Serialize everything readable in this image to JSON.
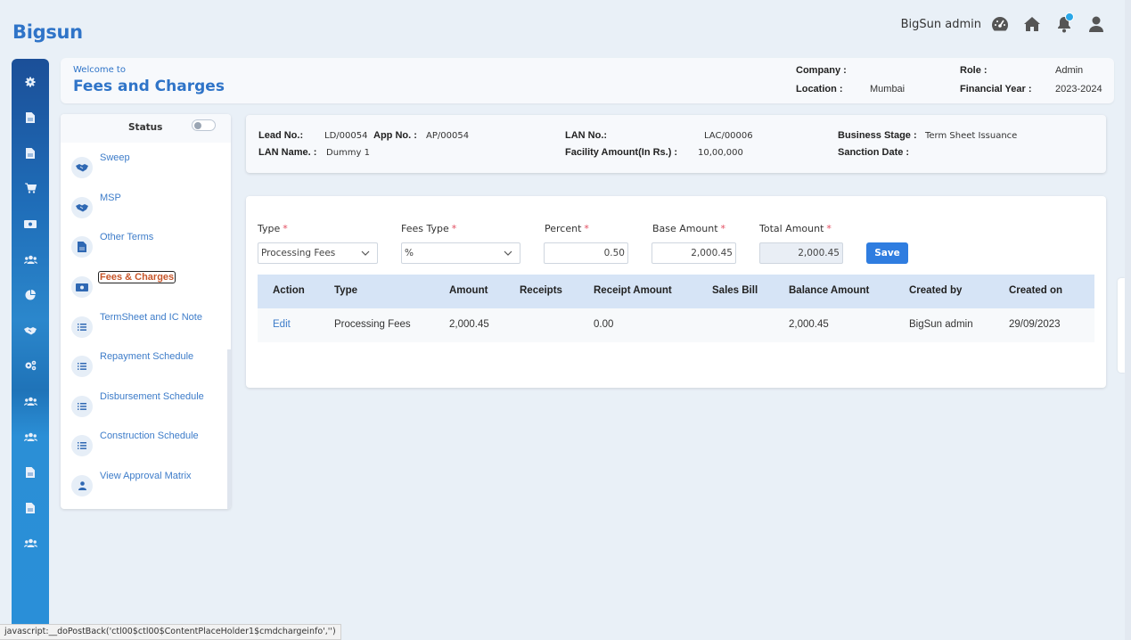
{
  "brand": "Bigsun",
  "topbar": {
    "user_name": "BigSun admin",
    "icons": [
      "dashboard-icon",
      "home-icon",
      "bell-icon",
      "user-icon"
    ],
    "notification_badge": true
  },
  "icon_rail": [
    "gear-icon",
    "document-icon",
    "document-icon",
    "cart-icon",
    "money-icon",
    "users-icon",
    "pie-chart-icon",
    "handshake-icon",
    "cogs-icon",
    "users-icon",
    "users-icon",
    "document-icon",
    "document-icon",
    "users-icon"
  ],
  "welcome": {
    "small": "Welcome to",
    "title": "Fees and Charges",
    "company_label": "Company :",
    "company_value": "",
    "location_label": "Location :",
    "location_value": "Mumbai",
    "role_label": "Role :",
    "role_value": "Admin",
    "fy_label": "Financial Year :",
    "fy_value": "2023-2024"
  },
  "left_panel": {
    "status_label": "Status",
    "status_toggle_on": false,
    "items": [
      {
        "label": "Sweep",
        "icon": "handshake-icon"
      },
      {
        "label": "MSP",
        "icon": "handshake-icon"
      },
      {
        "label": "Other Terms",
        "icon": "document-icon"
      },
      {
        "label": "Fees & Charges",
        "icon": "money-icon",
        "active": true
      },
      {
        "label": "TermSheet and IC Note",
        "icon": "list-icon"
      },
      {
        "label": "Repayment Schedule",
        "icon": "list-icon"
      },
      {
        "label": "Disbursement Schedule",
        "icon": "list-icon"
      },
      {
        "label": "Construction Schedule",
        "icon": "list-icon"
      },
      {
        "label": "View Approval Matrix",
        "icon": "user-icon"
      }
    ]
  },
  "info": {
    "lead_no_label": "Lead No.:",
    "lead_no": "LD/00054",
    "app_no_label": "App No. :",
    "app_no": "AP/00054",
    "lan_name_label": "LAN Name. :",
    "lan_name": "Dummy 1",
    "lan_no_label": "LAN No.:",
    "lan_no": "LAC/00006",
    "facility_label": "Facility Amount(In Rs.) :",
    "facility": "10,00,000",
    "stage_label": "Business Stage :",
    "stage": "Term Sheet Issuance",
    "sanction_label": "Sanction Date :",
    "sanction": ""
  },
  "form": {
    "type_label": "Type",
    "type_value": "Processing Fees",
    "fees_type_label": "Fees Type",
    "fees_type_value": "%",
    "percent_label": "Percent",
    "percent_value": "0.50",
    "base_label": "Base Amount",
    "base_value": "2,000.45",
    "total_label": "Total Amount",
    "total_value": "2,000.45",
    "required_mark": "*",
    "save_label": "Save"
  },
  "table": {
    "headers": [
      "Action",
      "Type",
      "Amount",
      "Receipts",
      "Receipt Amount",
      "Sales Bill",
      "Balance Amount",
      "Created by",
      "Created on"
    ],
    "rows": [
      {
        "action": "Edit",
        "type": "Processing Fees",
        "amount": "2,000.45",
        "receipts": "",
        "receipt_amount": "0.00",
        "sales_bill": "",
        "balance_amount": "2,000.45",
        "created_by": "BigSun admin",
        "created_on": "29/09/2023"
      }
    ]
  },
  "status_bar": "javascript:__doPostBack('ctl00$ctl00$ContentPlaceHolder1$cmdchargeinfo','')",
  "colors": {
    "brand": "#2f74c8",
    "accent": "#2f7de0",
    "table_header": "#d6e4f6",
    "active_item": "#c8562a",
    "link": "#3d7cc9"
  }
}
